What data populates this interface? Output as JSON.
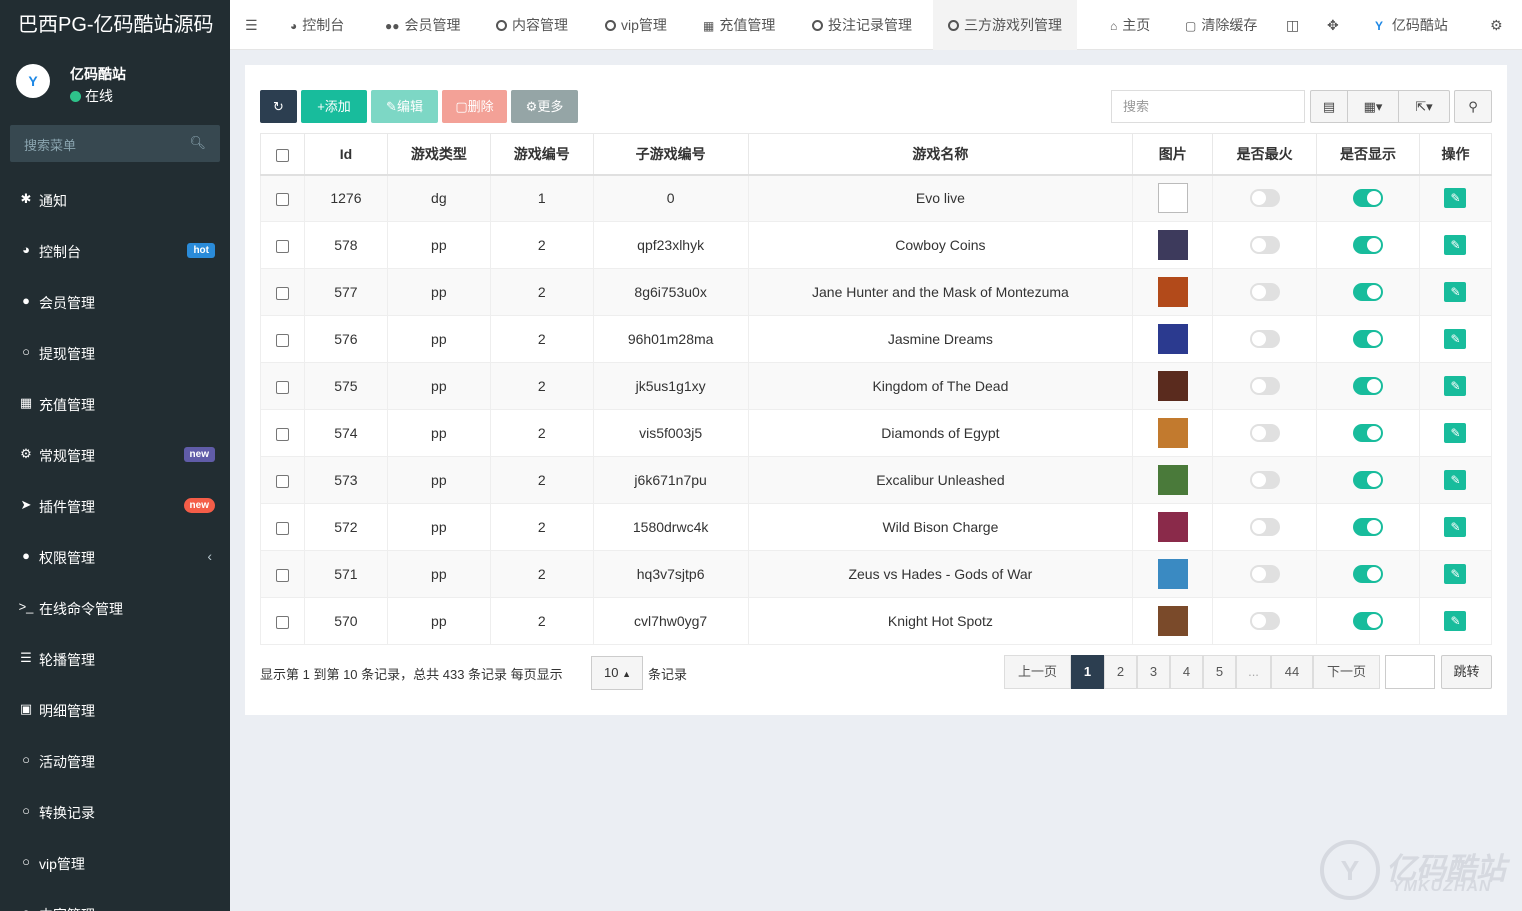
{
  "brand": {
    "title": "巴西PG-亿码酷站源码"
  },
  "user": {
    "name": "亿码酷站",
    "status": "在线",
    "avatar_text": "亿码酷站"
  },
  "sidebar": {
    "search_placeholder": "搜索菜单",
    "items": [
      {
        "label": "通知",
        "icon": "asterisk-icon"
      },
      {
        "label": "控制台",
        "icon": "dashboard-icon",
        "badge": "hot",
        "badge_color": "#2a8bd9"
      },
      {
        "label": "会员管理",
        "icon": "users-icon"
      },
      {
        "label": "提现管理",
        "icon": "circle-icon"
      },
      {
        "label": "充值管理",
        "icon": "grid-icon"
      },
      {
        "label": "常规管理",
        "icon": "cogs-icon",
        "badge": "new",
        "badge_color": "#605ca8"
      },
      {
        "label": "插件管理",
        "icon": "rocket-icon",
        "badge": "new",
        "badge_color": "#f45d48"
      },
      {
        "label": "权限管理",
        "icon": "group-icon",
        "chevron": true
      },
      {
        "label": "在线命令管理",
        "icon": "terminal-icon"
      },
      {
        "label": "轮播管理",
        "icon": "list-icon"
      },
      {
        "label": "明细管理",
        "icon": "calendar-icon"
      },
      {
        "label": "活动管理",
        "icon": "circle-icon"
      },
      {
        "label": "转换记录",
        "icon": "circle-icon"
      },
      {
        "label": "vip管理",
        "icon": "circle-icon"
      },
      {
        "label": "内容管理",
        "icon": "circle-icon"
      }
    ]
  },
  "topnav": {
    "tabs": [
      {
        "label": "控制台",
        "icon": "dashboard-icon"
      },
      {
        "label": "会员管理",
        "icon": "users-icon"
      },
      {
        "label": "内容管理",
        "icon": "circle-icon"
      },
      {
        "label": "vip管理",
        "icon": "circle-icon"
      },
      {
        "label": "充值管理",
        "icon": "grid-icon"
      },
      {
        "label": "投注记录管理",
        "icon": "circle-icon"
      },
      {
        "label": "三方游戏列管理",
        "icon": "circle-icon",
        "active": true
      }
    ],
    "home": "主页",
    "clear_cache": "清除缓存",
    "site_name": "亿码酷站"
  },
  "toolbar": {
    "add": "添加",
    "edit": "编辑",
    "delete": "删除",
    "more": "更多",
    "search_placeholder": "搜索"
  },
  "table": {
    "columns": [
      "Id",
      "游戏类型",
      "游戏编号",
      "子游戏编号",
      "游戏名称",
      "图片",
      "是否最火",
      "是否显示",
      "操作"
    ],
    "rows": [
      {
        "id": "1276",
        "type": "dg",
        "game_no": "1",
        "sub_no": "0",
        "name": "Evo live",
        "thumb": "broken",
        "hot": false,
        "show": true
      },
      {
        "id": "578",
        "type": "pp",
        "game_no": "2",
        "sub_no": "qpf23xlhyk",
        "name": "Cowboy Coins",
        "thumb": "#3d3a5c",
        "hot": false,
        "show": true
      },
      {
        "id": "577",
        "type": "pp",
        "game_no": "2",
        "sub_no": "8g6i753u0x",
        "name": "Jane Hunter and the Mask of Montezuma",
        "thumb": "#b24a1a",
        "hot": false,
        "show": true
      },
      {
        "id": "576",
        "type": "pp",
        "game_no": "2",
        "sub_no": "96h01m28ma",
        "name": "Jasmine Dreams",
        "thumb": "#2b3a8f",
        "hot": false,
        "show": true
      },
      {
        "id": "575",
        "type": "pp",
        "game_no": "2",
        "sub_no": "jk5us1g1xy",
        "name": "Kingdom of The Dead",
        "thumb": "#5a2b1e",
        "hot": false,
        "show": true
      },
      {
        "id": "574",
        "type": "pp",
        "game_no": "2",
        "sub_no": "vis5f003j5",
        "name": "Diamonds of Egypt",
        "thumb": "#c27a2e",
        "hot": false,
        "show": true
      },
      {
        "id": "573",
        "type": "pp",
        "game_no": "2",
        "sub_no": "j6k671n7pu",
        "name": "Excalibur Unleashed",
        "thumb": "#4a7a3a",
        "hot": false,
        "show": true
      },
      {
        "id": "572",
        "type": "pp",
        "game_no": "2",
        "sub_no": "1580drwc4k",
        "name": "Wild Bison Charge",
        "thumb": "#8a2a4a",
        "hot": false,
        "show": true
      },
      {
        "id": "571",
        "type": "pp",
        "game_no": "2",
        "sub_no": "hq3v7sjtp6",
        "name": "Zeus vs Hades - Gods of War",
        "thumb": "#3a8ac2",
        "hot": false,
        "show": true
      },
      {
        "id": "570",
        "type": "pp",
        "game_no": "2",
        "sub_no": "cvl7hw0yg7",
        "name": "Knight Hot Spotz",
        "thumb": "#7a4a2a",
        "hot": false,
        "show": true
      }
    ]
  },
  "pager": {
    "info": "显示第 1 到第 10 条记录，总共 433 条记录 每页显示",
    "per_page": "10",
    "suffix": "条记录",
    "prev": "上一页",
    "pages": [
      "1",
      "2",
      "3",
      "4",
      "5",
      "...",
      "44"
    ],
    "current": "1",
    "next": "下一页",
    "jump": "跳转"
  },
  "watermark": {
    "text": "亿码酷站",
    "sub": "YMKUZHAN"
  },
  "colors": {
    "sidebar_bg": "#222d32",
    "accent": "#18bc9c",
    "primary_dark": "#2c3e50"
  }
}
